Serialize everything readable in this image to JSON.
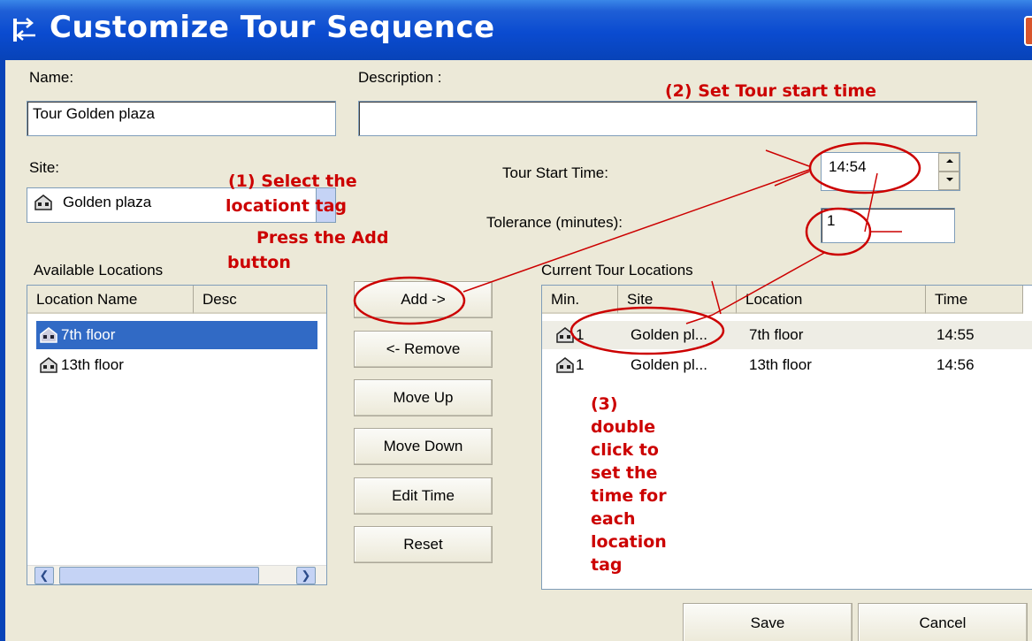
{
  "window": {
    "title": "Customize Tour Sequence"
  },
  "form": {
    "name_label": "Name:",
    "name_value": "Tour  Golden plaza",
    "description_label": "Description :",
    "description_value": "",
    "site_label": "Site:",
    "site_value": "Golden plaza",
    "start_time_label": "Tour Start Time:",
    "start_time_value": "14:54",
    "tolerance_label": "Tolerance (minutes):",
    "tolerance_value": "1"
  },
  "available": {
    "label": "Available Locations",
    "columns": [
      "Location Name",
      "Desc"
    ],
    "rows": [
      {
        "name": "7th floor",
        "selected": true
      },
      {
        "name": "13th floor",
        "selected": false
      }
    ]
  },
  "buttons": {
    "add": "Add ->",
    "remove": "<- Remove",
    "move_up": "Move Up",
    "move_down": "Move Down",
    "edit_time": "Edit Time",
    "reset": "Reset",
    "save": "Save",
    "cancel": "Cancel"
  },
  "current": {
    "label": "Current Tour Locations",
    "columns": [
      "Min.",
      "Site",
      "Location",
      "Time"
    ],
    "rows": [
      {
        "min": "1",
        "site": "Golden pl...",
        "location": "7th floor",
        "time": "14:55"
      },
      {
        "min": "1",
        "site": "Golden pl...",
        "location": "13th floor",
        "time": "14:56"
      }
    ]
  },
  "annotations": {
    "step1_line1": "(1) Select the",
    "step1_line2": "locationt tag",
    "step1_line3": "Press the Add",
    "step1_line4": "button",
    "step2": "(2)  Set Tour start time",
    "step3_lines": [
      "(3)",
      "double",
      "click to",
      "set the",
      "time for",
      "each",
      "location",
      "tag"
    ]
  },
  "colors": {
    "titlebar": "#0a4bd0",
    "selection": "#316ac5",
    "annotation": "#cc0000",
    "dialog_bg": "#ece9d8"
  }
}
